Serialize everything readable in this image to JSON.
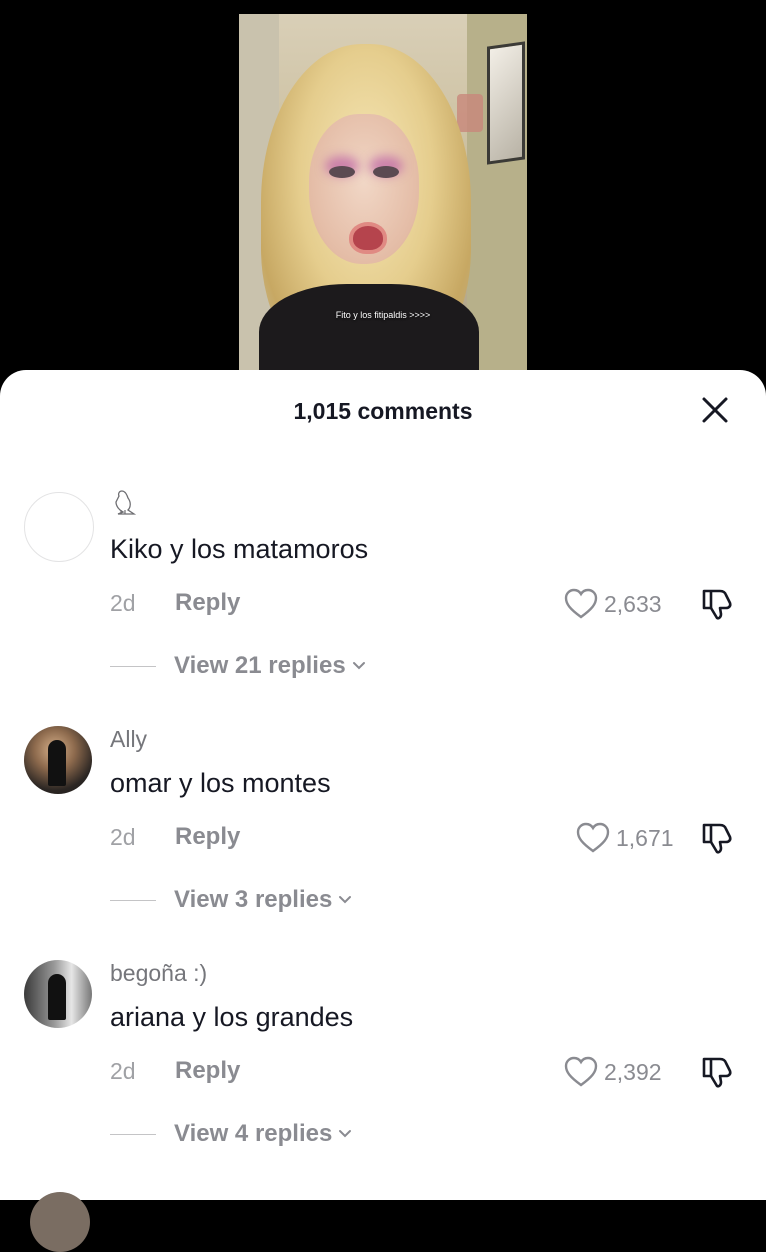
{
  "video": {
    "caption": "Fito y los fitipaldis >>>>"
  },
  "sheet": {
    "title": "1,015 comments",
    "close_icon": "close-icon"
  },
  "comments": [
    {
      "username": "",
      "user_icon": "hawk-glyph-icon",
      "text": "Kiko y los matamoros",
      "time": "2d",
      "reply_label": "Reply",
      "likes": "2,633",
      "view_replies": "View 21 replies"
    },
    {
      "username": "Ally",
      "text": "omar y los montes",
      "time": "2d",
      "reply_label": "Reply",
      "likes": "1,671",
      "view_replies": "View 3 replies"
    },
    {
      "username": "begoña :)",
      "text": "ariana y los grandes",
      "time": "2d",
      "reply_label": "Reply",
      "likes": "2,392",
      "view_replies": "View 4 replies"
    }
  ],
  "colors": {
    "primary_text": "#161823",
    "secondary_text": "#8a8b91",
    "background": "#ffffff"
  }
}
